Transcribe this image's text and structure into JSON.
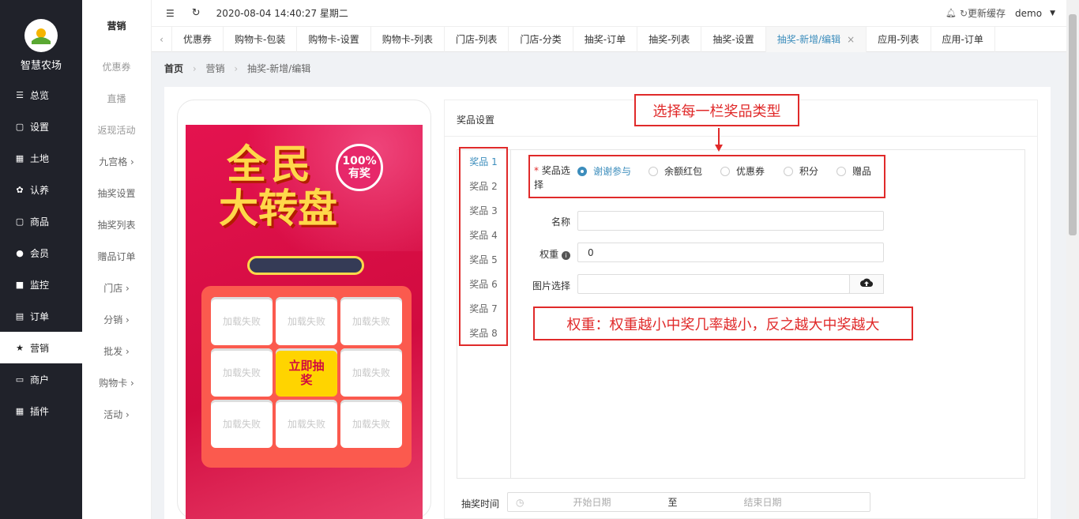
{
  "app": {
    "name": "智慧农场"
  },
  "sidebar": {
    "items": [
      {
        "icon": "sliders-icon",
        "glyph": "☰",
        "label": "总览"
      },
      {
        "icon": "bag-icon",
        "glyph": "▢",
        "label": "设置"
      },
      {
        "icon": "grid-icon",
        "glyph": "▦",
        "label": "土地"
      },
      {
        "icon": "plant-icon",
        "glyph": "✿",
        "label": "认养"
      },
      {
        "icon": "bag-icon",
        "glyph": "▢",
        "label": "商品"
      },
      {
        "icon": "user-icon",
        "glyph": "●",
        "label": "会员"
      },
      {
        "icon": "camera-icon",
        "glyph": "■",
        "label": "监控"
      },
      {
        "icon": "clipboard-icon",
        "glyph": "▤",
        "label": "订单"
      },
      {
        "icon": "star-icon",
        "glyph": "★",
        "label": "营销"
      },
      {
        "icon": "store-icon",
        "glyph": "▭",
        "label": "商户"
      },
      {
        "icon": "grid-icon",
        "glyph": "▦",
        "label": "插件"
      }
    ]
  },
  "subnav": {
    "title": "营销",
    "items": [
      "优惠券",
      "直播",
      "返现活动",
      "九宫格  ›",
      "抽奖设置",
      "抽奖列表",
      "赠品订单",
      "门店  ›",
      "分销  ›",
      "批发  ›",
      "购物卡  ›",
      "活动  ›"
    ]
  },
  "topbar": {
    "datetime": "2020-08-04 14:40:27 星期二",
    "refresh_cache": "更新缓存",
    "user": "demo"
  },
  "tabs": [
    "优惠券",
    "购物卡-包装",
    "购物卡-设置",
    "购物卡-列表",
    "门店-列表",
    "门店-分类",
    "抽奖-订单",
    "抽奖-列表",
    "抽奖-设置",
    "抽奖-新增/编辑",
    "应用-列表",
    "应用-订单"
  ],
  "active_tab_close": "×",
  "breadcrumb": {
    "home": "首页",
    "section": "营销",
    "page": "抽奖-新增/编辑"
  },
  "poster": {
    "title_line1": "全民",
    "title_line2": "大转盘",
    "badge_line1": "100%",
    "badge_line2": "有奖",
    "cell_text": "加载失败",
    "center_text": "立即抽奖"
  },
  "panel": {
    "title": "奖品设置"
  },
  "prize_tabs": [
    "奖品 1",
    "奖品 2",
    "奖品 3",
    "奖品 4",
    "奖品 5",
    "奖品 6",
    "奖品 7",
    "奖品 8"
  ],
  "form": {
    "type_label": "奖品选择",
    "type_options": [
      "谢谢参与",
      "余额红包",
      "优惠券",
      "积分",
      "赠品"
    ],
    "name_label": "名称",
    "name_value": "",
    "weight_label": "权重",
    "weight_value": "0",
    "image_label": "图片选择",
    "image_value": "",
    "time_label": "抽奖时间",
    "start_placeholder": "开始日期",
    "to": "至",
    "end_placeholder": "结束日期"
  },
  "annotations": {
    "top": "选择每一栏奖品类型",
    "weight": "权重：权重越小中奖几率越小，反之越大中奖越大"
  }
}
